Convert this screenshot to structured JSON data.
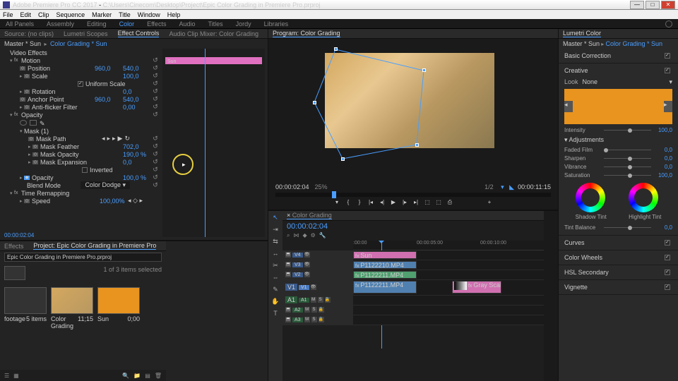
{
  "titlebar": {
    "app": "Adobe Premiere Pro CC 2017",
    "path": "C:\\Users\\Cinecom\\Desktop\\Project\\Epic Color Grading in Premiere Pro.prproj"
  },
  "menu": [
    "File",
    "Edit",
    "Clip",
    "Sequence",
    "Marker",
    "Title",
    "Window",
    "Help"
  ],
  "workspaces": [
    "All Panels",
    "Assembly",
    "Editing",
    "Color",
    "Effects",
    "Audio",
    "Titles",
    "Jordy",
    "Libraries"
  ],
  "source_tabs": [
    "Source: (no clips)",
    "Lumetri Scopes",
    "Effect Controls",
    "Audio Clip Mixer: Color Grading"
  ],
  "ec": {
    "breadcrumb_master": "Master * Sun",
    "breadcrumb_clip": "Color Grading * Sun",
    "section_video": "Video Effects",
    "clip_name": "Sun",
    "motion": "Motion",
    "position": "Position",
    "pos_x": "960,0",
    "pos_y": "540,0",
    "scale": "Scale",
    "scale_v": "100,0",
    "uniform": "Uniform Scale",
    "rotation": "Rotation",
    "rot_v": "0,0",
    "anchor": "Anchor Point",
    "anc_x": "960,0",
    "anc_y": "540,0",
    "flicker": "Anti-flicker Filter",
    "flick_v": "0,00",
    "opacity": "Opacity",
    "mask": "Mask (1)",
    "mpath": "Mask Path",
    "mfeather": "Mask Feather",
    "mfeather_v": "702,0",
    "mopacity": "Mask Opacity",
    "mopacity_v": "190,0 %",
    "mexpand": "Mask Expansion",
    "mexpand_v": "0,0",
    "inverted": "Inverted",
    "opacity_v": "100,0 %",
    "blend": "Blend Mode",
    "blend_v": "Color Dodge",
    "timeremap": "Time Remapping",
    "speed": "Speed",
    "speed_v": "100,00%",
    "tc": "00:00:02:04"
  },
  "program": {
    "tab": "Program: Color Grading",
    "tc_left": "00:00:02:04",
    "zoom": "25%",
    "pages": "1/2",
    "tc_right": "00:00:11:15"
  },
  "lumetri": {
    "title": "Lumetri Color",
    "bc_master": "Master * Sun",
    "bc_clip": "Color Grading * Sun",
    "basic": "Basic Correction",
    "creative": "Creative",
    "look": "Look",
    "look_v": "None",
    "intensity": "Intensity",
    "intensity_v": "100,0",
    "adjustments": "Adjustments",
    "faded": "Faded Film",
    "faded_v": "0,0",
    "sharpen": "Sharpen",
    "sharpen_v": "0,0",
    "vibrance": "Vibrance",
    "vibrance_v": "0,0",
    "saturation": "Saturation",
    "saturation_v": "100,0",
    "shadow": "Shadow Tint",
    "highlight": "Highlight Tint",
    "tint": "Tint Balance",
    "tint_v": "0,0",
    "curves": "Curves",
    "wheels": "Color Wheels",
    "hsl": "HSL Secondary",
    "vignette": "Vignette"
  },
  "project": {
    "tab_fx": "Effects",
    "tab_proj": "Project: Epic Color Grading in Premiere Pro",
    "filename": "Epic Color Grading in Premiere Pro.prproj",
    "sel": "1 of 3 items selected",
    "bins": [
      {
        "name": "footage",
        "meta": "5 items"
      },
      {
        "name": "Color Grading",
        "meta": "11;15"
      },
      {
        "name": "Sun",
        "meta": "0;00"
      }
    ]
  },
  "seq": {
    "tab": "Color Grading",
    "tc": "00:00:02:04",
    "ticks": [
      ":00:00",
      "00:00:05:00",
      "00:00:10:00"
    ],
    "tracks_v": [
      "V4",
      "V3",
      "V2",
      "V1"
    ],
    "tracks_a": [
      "A1",
      "A2",
      "A3"
    ],
    "clips": {
      "sun": "Sun",
      "p1": "P1122210.MP4",
      "p2": "P1122211.MP4",
      "p3": "P1122211.MP4",
      "gray": "Gray Scale.jpg"
    }
  }
}
